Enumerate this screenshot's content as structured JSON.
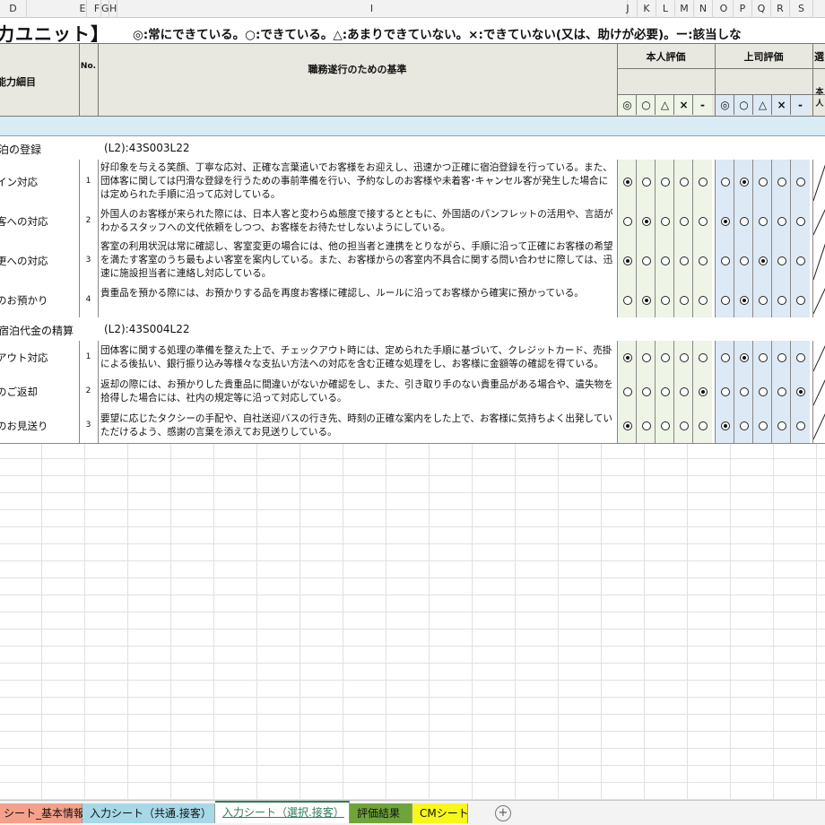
{
  "column_headers": [
    "D",
    "E",
    "F",
    "G",
    "H",
    "I",
    "J",
    "K",
    "L",
    "M",
    "N",
    "O",
    "P",
    "Q",
    "R",
    "S"
  ],
  "title": "力ユニット】",
  "legend": "◎:常にできている。○:できている。△:あまりできていない。×:できていない(又は、助けが必要)。ー:該当しな",
  "header": {
    "item_col": "能力細目",
    "no_col": "No.",
    "criteria_col": "職務遂行のための基準",
    "self_eval": "本人評価",
    "boss_eval": "上司評価",
    "select_col": "選",
    "select_sub": "本人",
    "symbols": [
      "◎",
      "○",
      "△",
      "×",
      "-"
    ]
  },
  "sections": [
    {
      "name": "泊の登録",
      "code": "(L2):43S003L22",
      "rows": [
        {
          "item": "イン対応",
          "no": "1",
          "desc": "好印象を与える笑顔、丁寧な応対、正確な言葉遣いでお客様をお迎えし、迅速かつ正確に宿泊登録を行っている。また、団体客に関しては円滑な登録を行うための事前準備を行い、予約なしのお客様や未着客･キャンセル客が発生した場合には定められた手順に沿って応対している。",
          "self": 0,
          "boss": 1
        },
        {
          "item": "客への対応",
          "no": "2",
          "desc": "外国人のお客様が来られた際には、日本人客と変わらぬ態度で接するとともに、外国語のパンフレットの活用や、言語がわかるスタッフへの文代依頼をしつつ、お客様をお待たせしないようにしている。",
          "self": 1,
          "boss": 0
        },
        {
          "item": "更への対応",
          "no": "3",
          "desc": "客室の利用状況は常に確認し、客室変更の場合には、他の担当者と連携をとりながら、手順に沿って正確にお客様の希望を満たす客室のうち最もよい客室を案内している。また、お客様からの客室内不具合に関する問い合わせに際しては、迅速に施設担当者に連絡し対応している。",
          "self": 0,
          "boss": 2
        },
        {
          "item": "のお預かり",
          "no": "4",
          "desc": "貴重品を預かる際には、お預かりする品を再度お客様に確認し、ルールに沿ってお客様から確実に預かっている。",
          "self": 1,
          "boss": 1
        }
      ]
    },
    {
      "name": "宿泊代金の精算",
      "code": "(L2):43S004L22",
      "rows": [
        {
          "item": "アウト対応",
          "no": "1",
          "desc": "団体客に関する処理の準備を整えた上で、チェックアウト時には、定められた手順に基づいて、クレジットカード、売掛による後払い、銀行振り込み等様々な支払い方法への対応を含む正確な処理をし、お客様に金額等の確認を得ている。",
          "self": 0,
          "boss": 1
        },
        {
          "item": "のご返却",
          "no": "2",
          "desc": "返却の際には、お預かりした貴重品に間違いがないか確認をし、また、引き取り手のない貴重品がある場合や、遺失物を拾得した場合には、社内の規定等に沿って対応している。",
          "self": 4,
          "boss": 4
        },
        {
          "item": "のお見送り",
          "no": "3",
          "desc": "要望に応じたタクシーの手配や、自社送迎バスの行き先、時刻の正確な案内をした上で、お客様に気持ちよく出発していただけるよう、感謝の言葉を添えてお見送りしている。",
          "self": 0,
          "boss": 0
        }
      ]
    }
  ],
  "tabs": [
    {
      "label": "シート_基本情報",
      "color": "#f4a08a"
    },
    {
      "label": "入力シート（共通.接客）",
      "color": "#a6d8e6"
    },
    {
      "label": "入力シート（選択.接客）",
      "color": "#ffffff"
    },
    {
      "label": "評価結果",
      "color": "#6fa43a"
    },
    {
      "label": "CMシート",
      "color": "#f7f71a"
    }
  ]
}
